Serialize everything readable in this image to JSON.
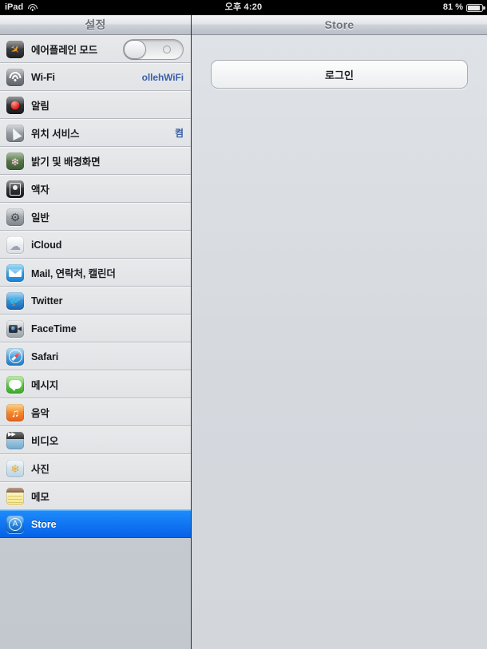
{
  "statusbar": {
    "carrier": "iPad",
    "wifi_icon": "wifi-icon",
    "time": "오후 4:20",
    "battery_percent": "81 %",
    "battery_level": 81,
    "battery_icon": "battery-icon"
  },
  "sidebar": {
    "title": "설정",
    "items": [
      {
        "label": "에어플레인 모드",
        "icon": "airplane-icon",
        "control": "switch",
        "switch_state": "off",
        "value": ""
      },
      {
        "label": "Wi-Fi",
        "icon": "wifi-icon",
        "control": "value",
        "value": "ollehWiFi"
      },
      {
        "label": "알림",
        "icon": "notifications-icon",
        "control": "none",
        "value": ""
      },
      {
        "label": "위치 서비스",
        "icon": "location-services-icon",
        "control": "value",
        "value": "켬"
      },
      {
        "label": "밝기 및 배경화면",
        "icon": "brightness-wallpaper-icon",
        "control": "none",
        "value": ""
      },
      {
        "label": "액자",
        "icon": "picture-frame-icon",
        "control": "none",
        "value": ""
      },
      {
        "label": "일반",
        "icon": "general-gear-icon",
        "control": "none",
        "value": ""
      },
      {
        "label": "iCloud",
        "icon": "icloud-icon",
        "control": "none",
        "value": ""
      },
      {
        "label": "Mail, 연락처, 캘린더",
        "icon": "mail-icon",
        "control": "none",
        "value": ""
      },
      {
        "label": "Twitter",
        "icon": "twitter-icon",
        "control": "none",
        "value": ""
      },
      {
        "label": "FaceTime",
        "icon": "facetime-icon",
        "control": "none",
        "value": ""
      },
      {
        "label": "Safari",
        "icon": "safari-icon",
        "control": "none",
        "value": ""
      },
      {
        "label": "메시지",
        "icon": "messages-icon",
        "control": "none",
        "value": ""
      },
      {
        "label": "음악",
        "icon": "music-icon",
        "control": "none",
        "value": ""
      },
      {
        "label": "비디오",
        "icon": "videos-icon",
        "control": "none",
        "value": ""
      },
      {
        "label": "사진",
        "icon": "photos-icon",
        "control": "none",
        "value": ""
      },
      {
        "label": "메모",
        "icon": "notes-icon",
        "control": "none",
        "value": ""
      },
      {
        "label": "Store",
        "icon": "store-icon",
        "control": "none",
        "value": "",
        "selected": true
      }
    ]
  },
  "detail": {
    "title": "Store",
    "login_label": "로그인"
  },
  "colors": {
    "selection_blue": "#0a66e8",
    "value_blue": "#3a60a8",
    "nav_title_gray": "#6d727b"
  }
}
